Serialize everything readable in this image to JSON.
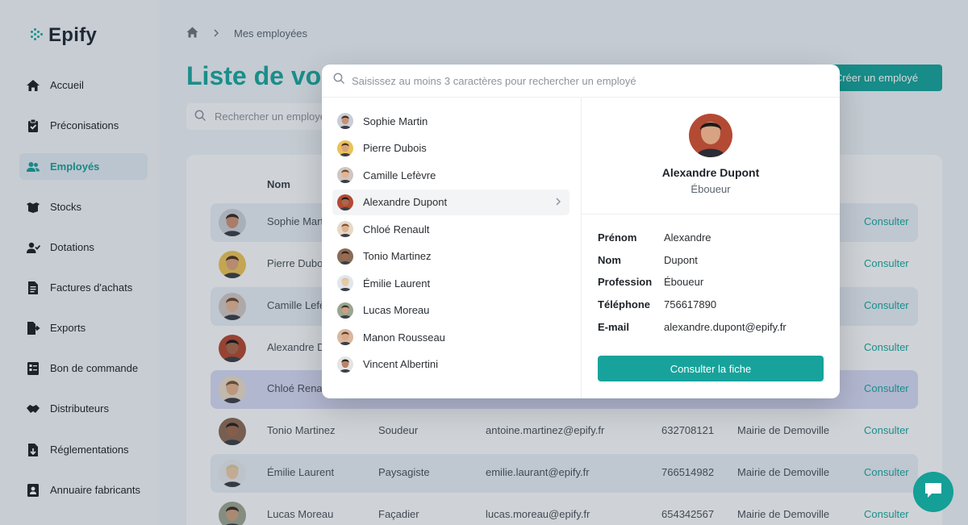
{
  "app": {
    "logo": "Epify"
  },
  "sidebar": {
    "items": [
      {
        "label": "Accueil",
        "icon": "home-icon",
        "active": false
      },
      {
        "label": "Préconisations",
        "icon": "clipboard-check-icon",
        "active": false
      },
      {
        "label": "Employés",
        "icon": "users-icon",
        "active": true
      },
      {
        "label": "Stocks",
        "icon": "box-icon",
        "active": false
      },
      {
        "label": "Dotations",
        "icon": "user-check-icon",
        "active": false
      },
      {
        "label": "Factures d'achats",
        "icon": "invoice-icon",
        "active": false
      },
      {
        "label": "Exports",
        "icon": "export-icon",
        "active": false
      },
      {
        "label": "Bon de commande",
        "icon": "order-icon",
        "active": false
      },
      {
        "label": "Distributeurs",
        "icon": "handshake-icon",
        "active": false
      },
      {
        "label": "Réglementations",
        "icon": "download-doc-icon",
        "active": false
      },
      {
        "label": "Annuaire fabricants",
        "icon": "contact-card-icon",
        "active": false
      }
    ]
  },
  "breadcrumb": {
    "current": "Mes employées"
  },
  "page": {
    "title": "Liste de vos",
    "create_button": "Créer un employé",
    "search_placeholder": "Rechercher un employé"
  },
  "table": {
    "columns": {
      "name": "Nom"
    },
    "rows": [
      {
        "name": "Sophie Mart",
        "profession": "",
        "email": "",
        "phone": "",
        "company": "",
        "action": "Consulter"
      },
      {
        "name": "Pierre Dubo",
        "profession": "",
        "email": "",
        "phone": "",
        "company": "",
        "action": "Consulter"
      },
      {
        "name": "Camille Lefè",
        "profession": "",
        "email": "",
        "phone": "",
        "company": "",
        "action": "Consulter"
      },
      {
        "name": "Alexandre D",
        "profession": "",
        "email": "",
        "phone": "",
        "company": "",
        "action": "Consulter"
      },
      {
        "name": "Chloé Rena",
        "profession": "",
        "email": "",
        "phone": "",
        "company": "",
        "action": "Consulter"
      },
      {
        "name": "Tonio Martinez",
        "profession": "Soudeur",
        "email": "antoine.martinez@epify.fr",
        "phone": "632708121",
        "company": "Mairie de Demoville",
        "action": "Consulter"
      },
      {
        "name": "Émilie Laurent",
        "profession": "Paysagiste",
        "email": "emilie.laurant@epify.fr",
        "phone": "766514982",
        "company": "Mairie de Demoville",
        "action": "Consulter"
      },
      {
        "name": "Lucas Moreau",
        "profession": "Façadier",
        "email": "lucas.moreau@epify.fr",
        "phone": "654342567",
        "company": "Mairie de Demoville",
        "action": "Consulter"
      }
    ]
  },
  "modal": {
    "search_placeholder": "Saisissez au moins 3 caractères pour rechercher un employé",
    "results": [
      "Sophie Martin",
      "Pierre Dubois",
      "Camille Lefèvre",
      "Alexandre Dupont",
      "Chloé Renault",
      "Tonio Martinez",
      "Émilie Laurent",
      "Lucas Moreau",
      "Manon Rousseau",
      "Vincent Albertini"
    ],
    "selected": {
      "name": "Alexandre Dupont",
      "role": "Éboueur",
      "fields": [
        {
          "label": "Prénom",
          "value": "Alexandre"
        },
        {
          "label": "Nom",
          "value": "Dupont"
        },
        {
          "label": "Profession",
          "value": "Éboueur"
        },
        {
          "label": "Téléphone",
          "value": "756617890"
        },
        {
          "label": "E-mail",
          "value": "alexandre.dupont@epify.fr"
        }
      ],
      "button": "Consulter la fiche"
    }
  },
  "colors": {
    "accent": "#17a39b",
    "highlight_row": "#d3d7f2"
  }
}
